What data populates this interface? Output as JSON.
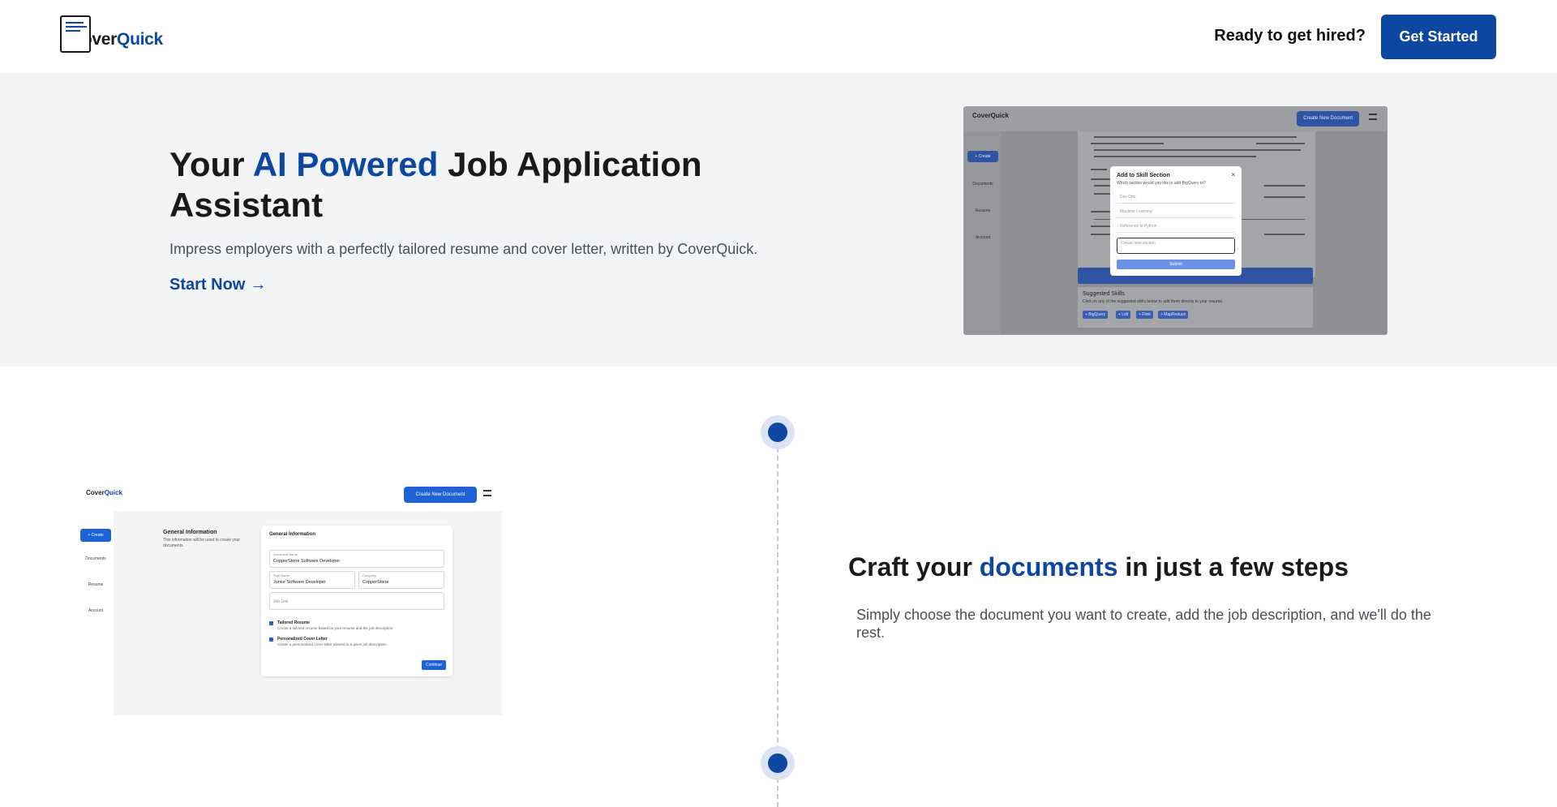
{
  "header": {
    "logo_prefix": "Cover",
    "logo_accent": "Quick",
    "tagline": "Ready to get hired?",
    "cta_label": "Get Started",
    "accent_color": "#0d47a1"
  },
  "hero": {
    "title_pre": "Your",
    "title_accent": "AI Powered",
    "title_post": "Job Application Assistant",
    "subtitle": "Impress employers with a perfectly tailored resume and cover letter, written by CoverQuick.",
    "start_label": "Start Now",
    "start_arrow": "→"
  },
  "mock_hero": {
    "logo": "CoverQuick",
    "create_doc": "Create New Document",
    "side_create": "+ Create",
    "side_items": [
      "Documents",
      "Resume",
      "Account"
    ],
    "modal_title": "Add to Skill Section",
    "modal_close": "×",
    "modal_sub": "Which section would you like to add BigQuery to?",
    "modal_options": [
      "Dev Ops",
      "Machine Learning",
      "Reference to Python"
    ],
    "modal_input": "Create new section",
    "modal_submit": "Submit",
    "suggested_title": "Suggested Skills",
    "suggested_sub": "Click on any of the suggested skills below to add them directly to your resume.",
    "chips": [
      "+ BigQuery",
      "+ Lidl",
      "+ Flink",
      "+ MapReduce"
    ]
  },
  "mock_form": {
    "logo_prefix": "Cover",
    "logo_accent": "Quick",
    "create_doc": "Create New Document",
    "side_create": "+ Create",
    "side_items": [
      "Documents",
      "Resume",
      "Account"
    ],
    "section_title": "General Information",
    "section_desc": "This information will be used to create your documents.",
    "card_title": "General Information",
    "doc_name_label": "Document Name",
    "doc_name_value": "CopperStone Software Developer",
    "role_label": "Role Name",
    "role_value": "Junior Software Developer",
    "company_label": "Company",
    "company_value": "CopperStone",
    "job_link_label": "Job Link",
    "opt1_title": "Tailored Resume",
    "opt1_desc": "Create a tailored resume based on your resume and the job description.",
    "opt2_title": "Personalized Cover Letter",
    "opt2_desc": "Create a personalized cover letter tailored to a given job description.",
    "continue": "Continue"
  },
  "steps": {
    "title_pre": "Craft your",
    "title_accent": "documents",
    "title_post": "in just a few steps",
    "subtitle": "Simply choose the document you want to create, add the job description, and we'll do the rest."
  }
}
